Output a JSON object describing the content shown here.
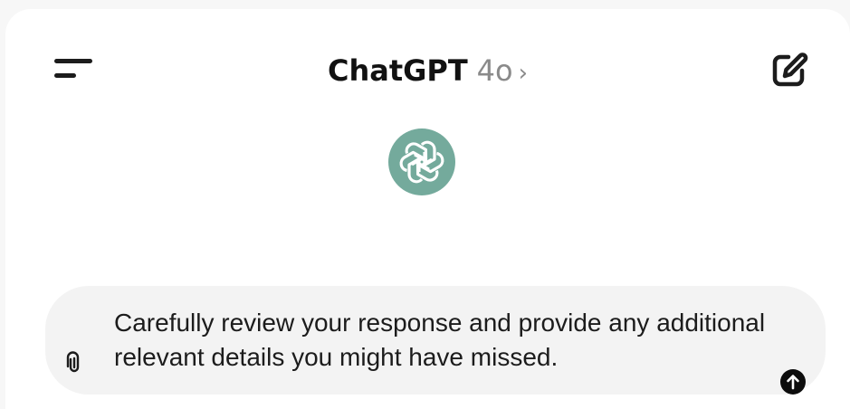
{
  "header": {
    "app_name": "ChatGPT",
    "model": "4o",
    "model_chevron": "›",
    "menu_icon": "menu-icon",
    "new_chat_icon": "new-chat-icon"
  },
  "logo": {
    "icon": "openai-logo-icon",
    "color": "#74aa9c"
  },
  "composer": {
    "text": "Carefully review your response and provide any additional relevant details you might have missed.",
    "attach_icon": "paperclip-icon",
    "send_icon": "send-arrow-icon"
  }
}
